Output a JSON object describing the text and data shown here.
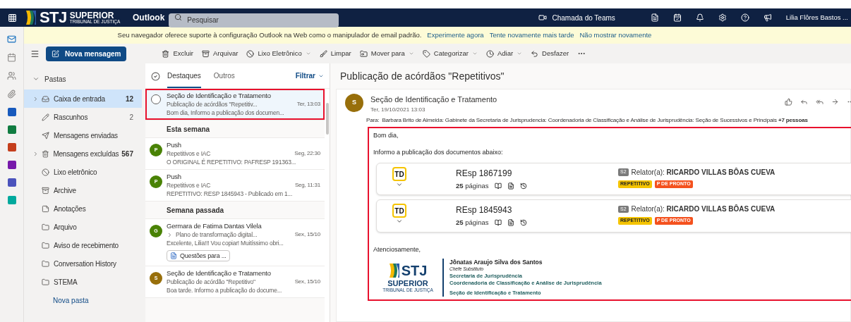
{
  "header": {
    "logo": {
      "mark": "STJ",
      "line1": "SUPERIOR",
      "line2": "TRIBUNAL DE JUSTIÇA"
    },
    "app_name": "Outlook",
    "search": {
      "placeholder": "Pesquisar"
    },
    "teams_call": "Chamada do Teams",
    "user": "Lilia Flôres Bastos ..."
  },
  "rail": [
    {
      "kind": "mail",
      "selected": true
    },
    {
      "kind": "calendar",
      "selected": false
    },
    {
      "kind": "people",
      "selected": false
    },
    {
      "kind": "files",
      "selected": false
    },
    {
      "kind": "tile",
      "color": "#185abd",
      "selected": false
    },
    {
      "kind": "tile",
      "color": "#107c41",
      "selected": false
    },
    {
      "kind": "tile",
      "color": "#c43e1c",
      "selected": false
    },
    {
      "kind": "tile",
      "color": "#7719aa",
      "selected": false
    },
    {
      "kind": "tile",
      "color": "#4b53bc",
      "selected": false
    },
    {
      "kind": "tile",
      "color": "#00a99d",
      "selected": false
    }
  ],
  "banner": {
    "text": "Seu navegador oferece suporte à configuração Outlook na Web como o manipulador de email padrão.",
    "links": [
      "Experimente agora",
      "Tente novamente mais tarde",
      "Não mostrar novamente"
    ]
  },
  "toolbar": {
    "new_message": "Nova mensagem",
    "actions": [
      {
        "label": "Excluir",
        "dropdown": false
      },
      {
        "label": "Arquivar",
        "dropdown": false
      },
      {
        "label": "Lixo Eletrônico",
        "dropdown": true
      },
      {
        "label": "Limpar",
        "dropdown": false
      },
      {
        "label": "Mover para",
        "dropdown": true
      },
      {
        "label": "Categorizar",
        "dropdown": true
      },
      {
        "label": "Adiar",
        "dropdown": true
      },
      {
        "label": "Desfazer",
        "dropdown": false
      }
    ]
  },
  "folders": {
    "title": "Pastas",
    "expanded": true,
    "items": [
      {
        "name": "Caixa de entrada",
        "count": "12",
        "unread": true,
        "has_children": true,
        "selected": true
      },
      {
        "name": "Rascunhos",
        "count": "2",
        "unread": false,
        "has_children": false,
        "selected": false
      },
      {
        "name": "Mensagens enviadas",
        "has_children": false,
        "selected": false
      },
      {
        "name": "Mensagens excluídas",
        "count": "567",
        "unread": true,
        "has_children": true,
        "selected": false
      },
      {
        "name": "Lixo eletrônico",
        "has_children": false,
        "selected": false
      },
      {
        "name": "Archive",
        "has_children": false,
        "selected": false
      },
      {
        "name": "Anotações",
        "has_children": false,
        "selected": false
      },
      {
        "name": "Arquivo",
        "has_children": false,
        "selected": false
      },
      {
        "name": "Aviso de recebimento",
        "has_children": false,
        "selected": false
      },
      {
        "name": "Conversation History",
        "has_children": false,
        "selected": false
      },
      {
        "name": "STEMA",
        "has_children": false,
        "selected": false
      }
    ],
    "new_folder": "Nova pasta"
  },
  "message_list": {
    "tabs": [
      {
        "label": "Destaques",
        "selected": true
      },
      {
        "label": "Outros",
        "selected": false
      }
    ],
    "filter": "Filtrar",
    "items": [
      {
        "kind": "message",
        "sender": "Seção de Identificação e Tratamento",
        "subject": "Publicação de acórdãos \"Repetitiv...",
        "time": "Ter, 13:03",
        "preview": "Bom dia, Informo a publicação dos documen...",
        "selected": true,
        "highlighted": true,
        "thread": false
      },
      {
        "kind": "group",
        "label": "Esta semana"
      },
      {
        "kind": "message",
        "avatar": "P",
        "color": "#498205",
        "sender": "Push",
        "subject": "Repetitivos e IAC",
        "time": "Seg, 22:30",
        "preview": "O ORIGINAL É REPETITIVO: PAFRESP 191363...",
        "selected": false,
        "highlighted": false,
        "thread": false
      },
      {
        "kind": "message",
        "avatar": "P",
        "color": "#498205",
        "sender": "Push",
        "subject": "Repetitivos e IAC",
        "time": "Seg, 11:31",
        "preview": "REPETITIVO: RESP 1845943 - Publicado em 1...",
        "selected": false,
        "highlighted": false,
        "thread": false
      },
      {
        "kind": "group",
        "label": "Semana passada"
      },
      {
        "kind": "message",
        "avatar": "G",
        "color": "#498205",
        "sender": "Germara de Fatima Dantas Vilela",
        "subject": "Plano de transformação digital...",
        "time": "Sex, 15/10",
        "preview": "Excelente, Lilia!!! Vou copiar! Muitíssimo obri...",
        "attachment": "Questões para ...",
        "selected": false,
        "highlighted": false,
        "thread": true
      },
      {
        "kind": "message",
        "avatar": "S",
        "color": "#986f0b",
        "sender": "Seção de Identificação e Tratamento",
        "subject": "Publicação de acórdão \"Repetitivo\"",
        "time": "Sex, 15/10",
        "preview": "Boa tarde. Informo a publicação do docume...",
        "selected": false,
        "highlighted": false,
        "thread": false
      }
    ]
  },
  "reading": {
    "subject": "Publicação de acórdãos \"Repetitivos\"",
    "avatar": "S",
    "sender": "Seção de Identificação e Tratamento",
    "date": "Ter, 19/10/2021 13:03",
    "to_label": "Para:",
    "recipients": "Barbara Brito de Almeida: Gabinete da Secretaria de Jurisprudencia: Coordenadoria de Classificação e Análise de Jurisprudência: Seção de Sucessivos e Principais **+7 pessoas**",
    "body": {
      "highlighted": true,
      "greeting": "Bom dia,",
      "intro": "Informo a publicação dos documentos abaixo:",
      "documents": [
        {
          "logo": "TD",
          "title": "REsp 1867199",
          "pages": "**25** páginas",
          "badge": "S2",
          "relator": "Relator(a): **RICARDO VILLAS BÔAS CUEVA**",
          "tags": [
            {
              "label": "REPETITIVO",
              "color": "#f5c400"
            },
            {
              "label": "P DE PRONTO",
              "color": "#f4511e"
            }
          ]
        },
        {
          "logo": "TD",
          "title": "REsp 1845943",
          "pages": "**25** páginas",
          "badge": "S2",
          "relator": "Relator(a): **RICARDO VILLAS BÔAS CUEVA**",
          "tags": [
            {
              "label": "REPETITIVO",
              "color": "#f5c400"
            },
            {
              "label": "P DE PRONTO",
              "color": "#f4511e"
            }
          ]
        }
      ],
      "closing": "Atenciosamente,",
      "signature": {
        "logo": {
          "mark": "STJ",
          "line1": "SUPERIOR",
          "line2": "TRIBUNAL DE JUSTIÇA"
        },
        "name": "Jônatas Araujo Silva dos Santos",
        "role": "Chefe Substituto",
        "lines": [
          "Secretaria de Jurisprudência",
          "Coordenadoria de Classificação e Análise de Jurisprudência"
        ],
        "unit": "Seção de Identificação e Tratamento"
      }
    }
  }
}
